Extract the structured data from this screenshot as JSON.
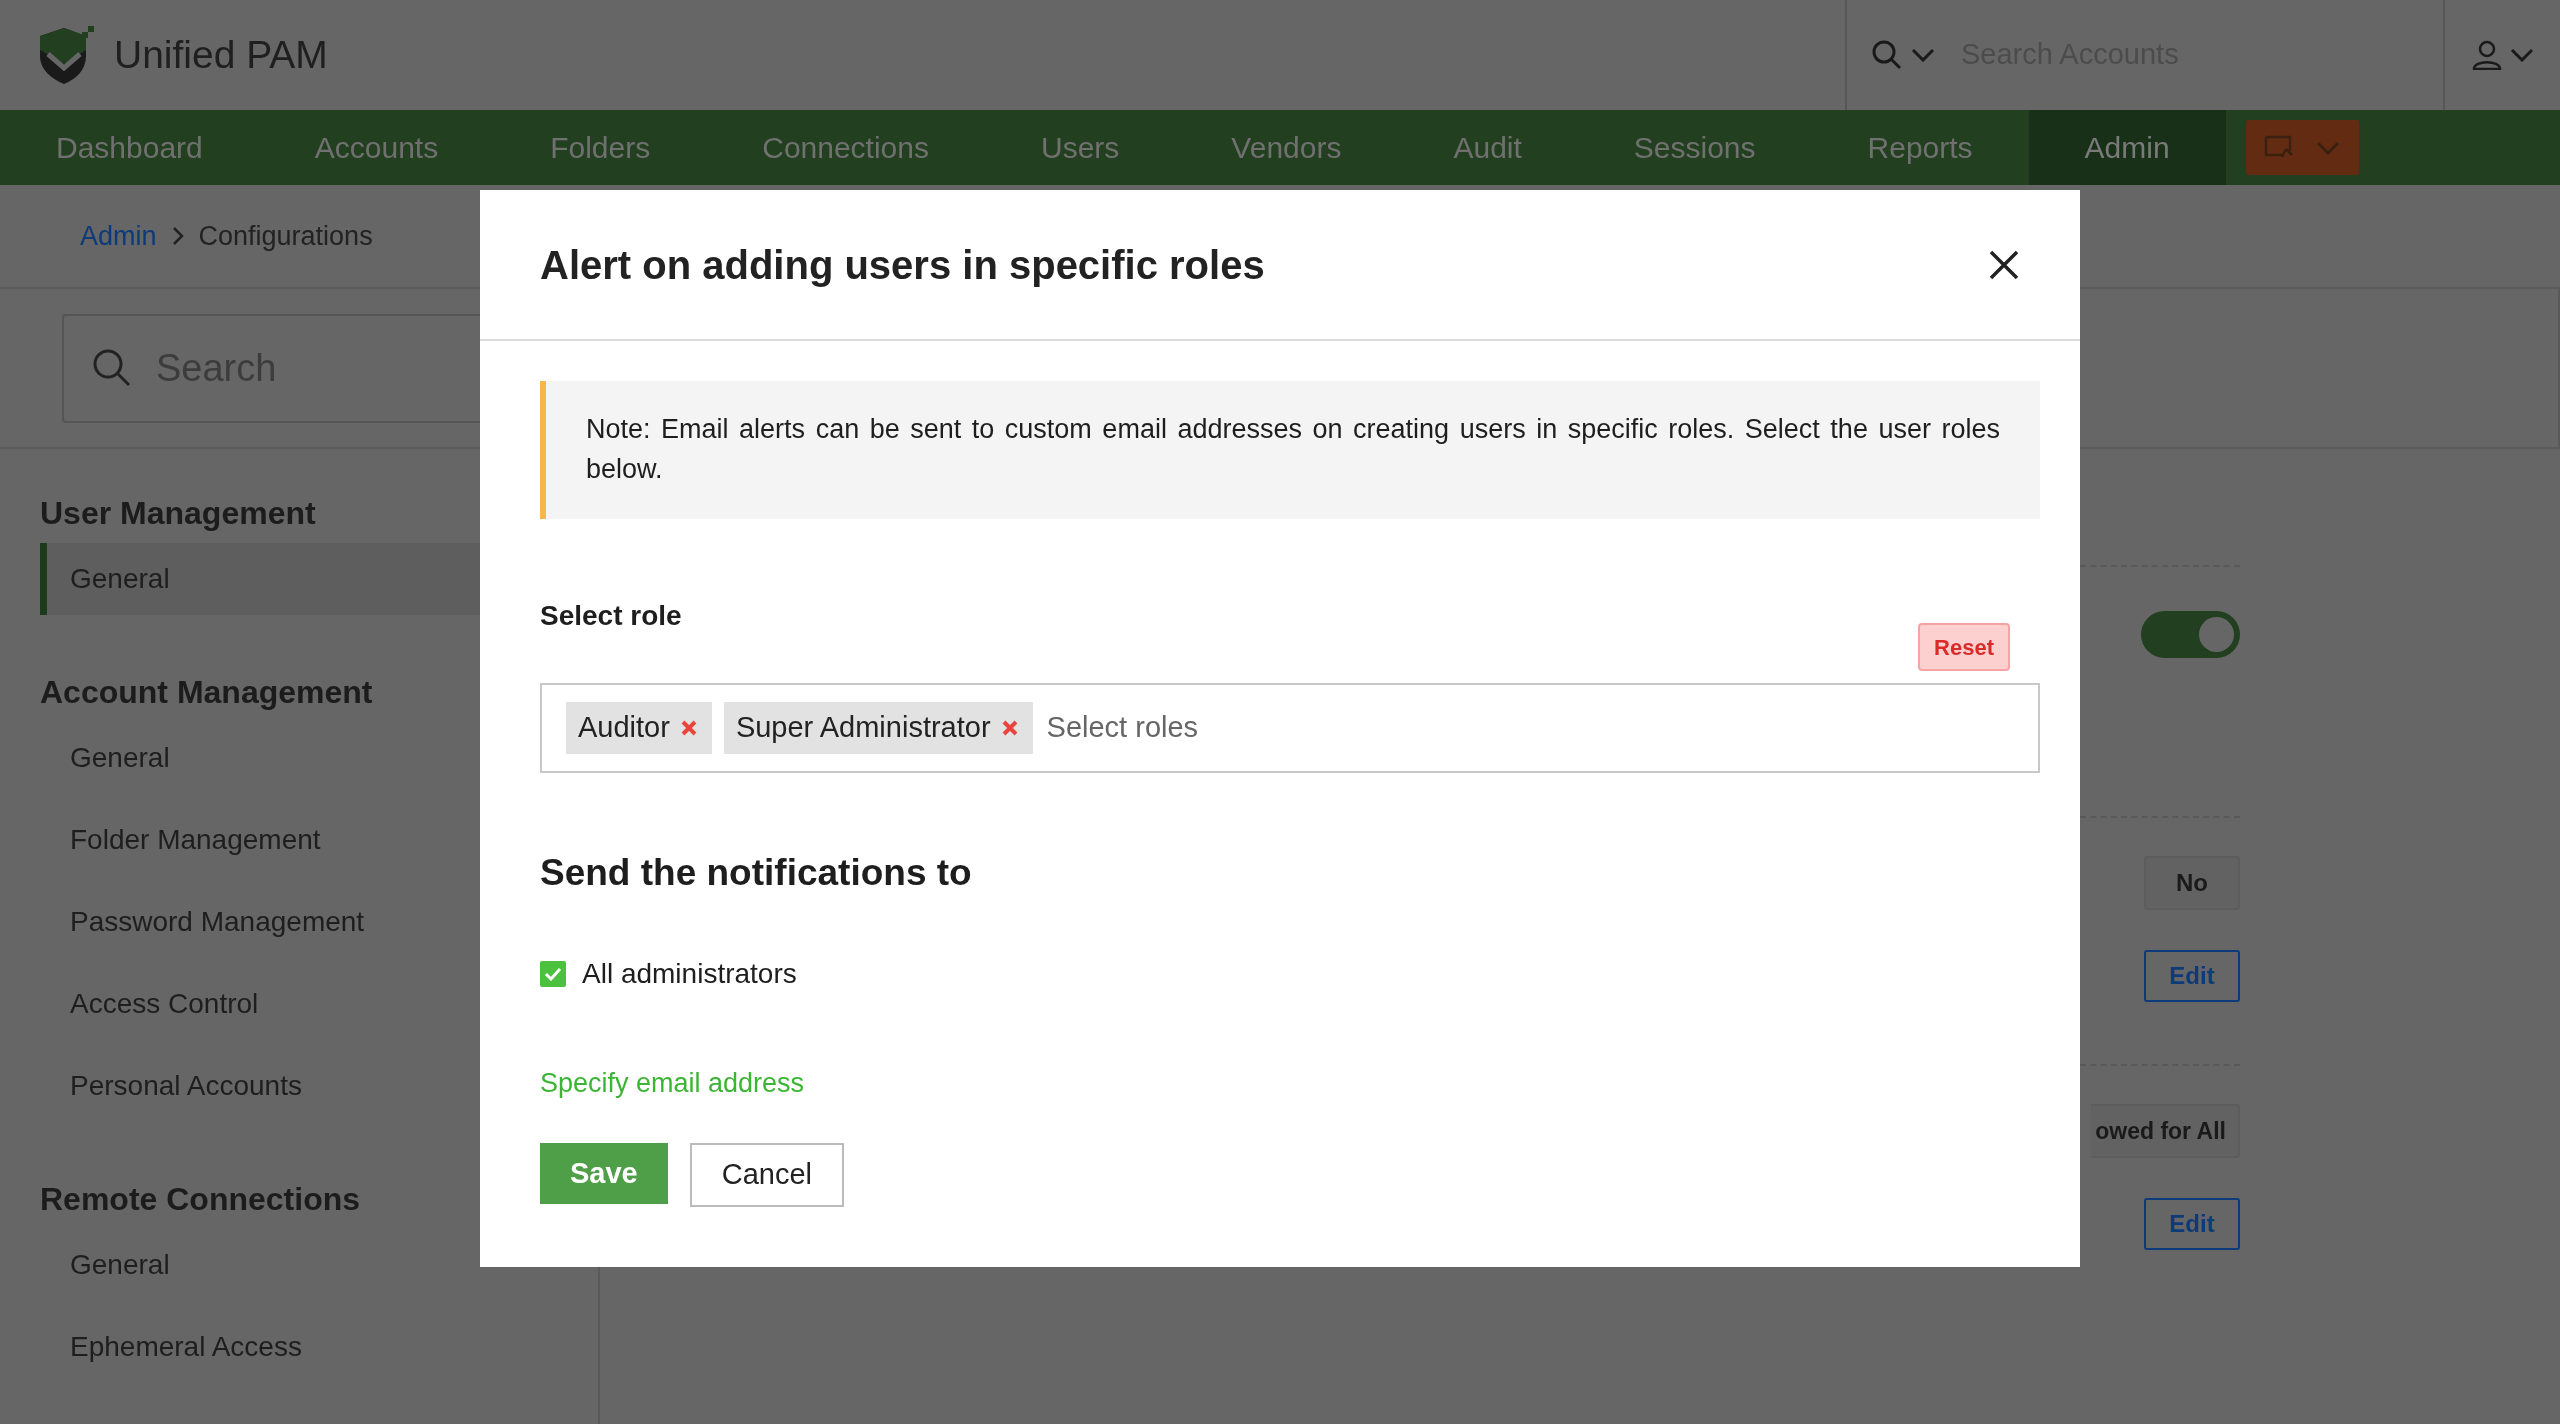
{
  "app": {
    "title": "Unified PAM"
  },
  "header_search": {
    "placeholder": "Search Accounts"
  },
  "nav": [
    {
      "label": "Dashboard",
      "selected": false
    },
    {
      "label": "Accounts",
      "selected": false
    },
    {
      "label": "Folders",
      "selected": false
    },
    {
      "label": "Connections",
      "selected": false
    },
    {
      "label": "Users",
      "selected": false
    },
    {
      "label": "Vendors",
      "selected": false
    },
    {
      "label": "Audit",
      "selected": false
    },
    {
      "label": "Sessions",
      "selected": false
    },
    {
      "label": "Reports",
      "selected": false
    },
    {
      "label": "Admin",
      "selected": true
    }
  ],
  "breadcrumb": [
    "Admin",
    "Configurations"
  ],
  "sidebar": {
    "search_placeholder": "Search",
    "sections": [
      {
        "title": "User Management",
        "items": [
          {
            "label": "General",
            "selected": true
          }
        ]
      },
      {
        "title": "Account Management",
        "items": [
          {
            "label": "General",
            "selected": false
          },
          {
            "label": "Folder Management",
            "selected": false
          },
          {
            "label": "Password Management",
            "selected": false
          },
          {
            "label": "Access Control",
            "selected": false
          },
          {
            "label": "Personal Accounts",
            "selected": false
          }
        ]
      },
      {
        "title": "Remote Connections",
        "items": [
          {
            "label": "General",
            "selected": false
          },
          {
            "label": "Ephemeral Access",
            "selected": false
          }
        ]
      }
    ]
  },
  "background_settings": [
    {
      "kind": "toggle",
      "on": true
    },
    {
      "kind": "value",
      "label": "No"
    },
    {
      "kind": "edit",
      "label": "Edit"
    },
    {
      "kind": "value",
      "label": "owed for All"
    },
    {
      "kind": "edit",
      "label": "Edit"
    }
  ],
  "modal": {
    "title": "Alert on adding users in specific roles",
    "note": "Note: Email alerts can be sent to custom email addresses on creating users in specific roles. Select the user roles below.",
    "role_label": "Select role",
    "reset": "Reset",
    "roles": [
      "Auditor",
      "Super Administrator"
    ],
    "roles_placeholder": "Select roles",
    "section_title": "Send the notifications to",
    "options": [
      {
        "label": "All administrators",
        "checked": true
      }
    ],
    "email_link": "Specify email address",
    "buttons": [
      {
        "label": "Save",
        "kind": "primary"
      },
      {
        "label": "Cancel",
        "kind": "secondary"
      }
    ]
  }
}
